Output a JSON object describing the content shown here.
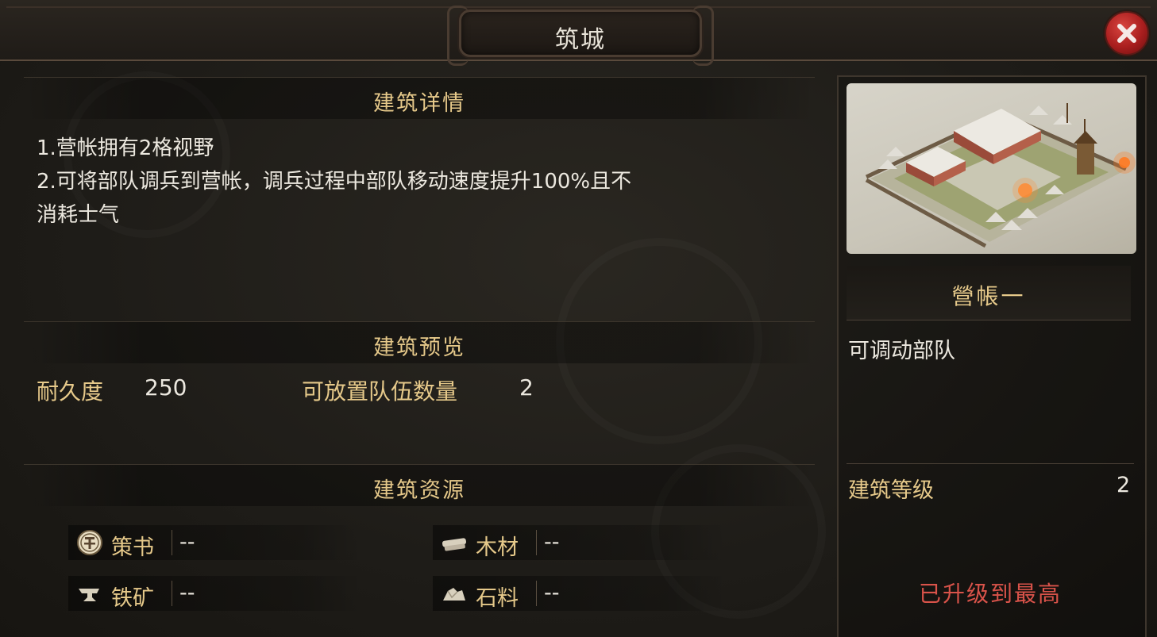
{
  "window": {
    "title": "筑城",
    "close_icon": "close-icon"
  },
  "details": {
    "heading": "建筑详情",
    "lines": [
      "1.营帐拥有2格视野",
      "2.可将部队调兵到营帐，调兵过程中部队移动速度提升100%且不",
      "消耗士气"
    ]
  },
  "preview_section": {
    "heading": "建筑预览",
    "durability_label": "耐久度",
    "durability_value": "250",
    "teams_label": "可放置队伍数量",
    "teams_value": "2"
  },
  "resources": {
    "heading": "建筑资源",
    "items": [
      {
        "icon": "scroll-icon",
        "name": "策书",
        "value": "--"
      },
      {
        "icon": "wood-icon",
        "name": "木材",
        "value": "--"
      },
      {
        "icon": "anvil-icon",
        "name": "铁矿",
        "value": "--"
      },
      {
        "icon": "stone-icon",
        "name": "石料",
        "value": "--"
      }
    ]
  },
  "building_card": {
    "name": "營帳一",
    "description": "可调动部队",
    "level_label": "建筑等级",
    "level_value": "2",
    "status": "已升级到最高"
  },
  "colors": {
    "gold_text": "#e6c98a",
    "body_text": "#ece8df",
    "status_red": "#d9534a",
    "close_red": "#a91e1e"
  }
}
